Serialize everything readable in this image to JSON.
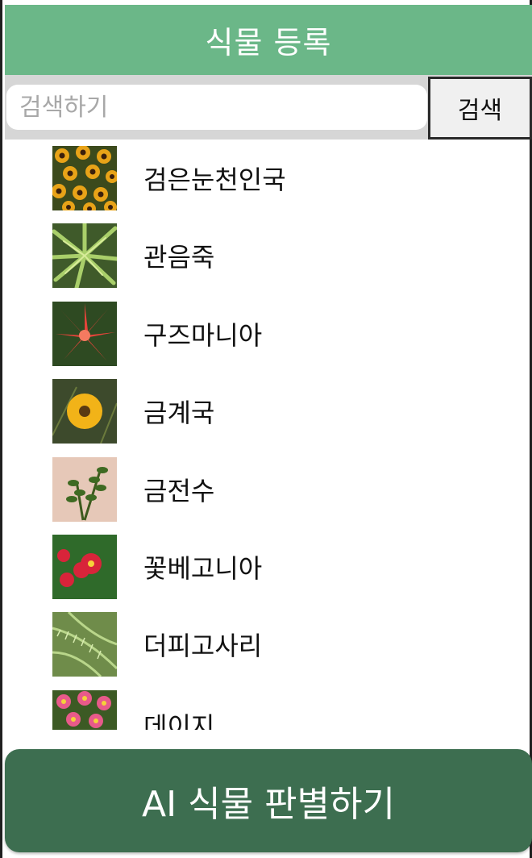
{
  "header": {
    "title": "식물 등록"
  },
  "search": {
    "placeholder": "검색하기",
    "value": "",
    "button_label": "검색"
  },
  "plants": [
    {
      "name": "검은눈천인국",
      "thumb": "black-eyed-susan"
    },
    {
      "name": "관음죽",
      "thumb": "lady-palm"
    },
    {
      "name": "구즈마니아",
      "thumb": "guzmania"
    },
    {
      "name": "금계국",
      "thumb": "coreopsis"
    },
    {
      "name": "금전수",
      "thumb": "zz-plant"
    },
    {
      "name": "꽃베고니아",
      "thumb": "begonia"
    },
    {
      "name": "더피고사리",
      "thumb": "fern"
    },
    {
      "name": "데이지",
      "thumb": "daisy"
    }
  ],
  "ai_button": {
    "label": "AI 식물 판별하기"
  },
  "colors": {
    "header": "#6bb788",
    "ai_button": "#3d6e50",
    "search_bg": "#d6d6d6"
  }
}
